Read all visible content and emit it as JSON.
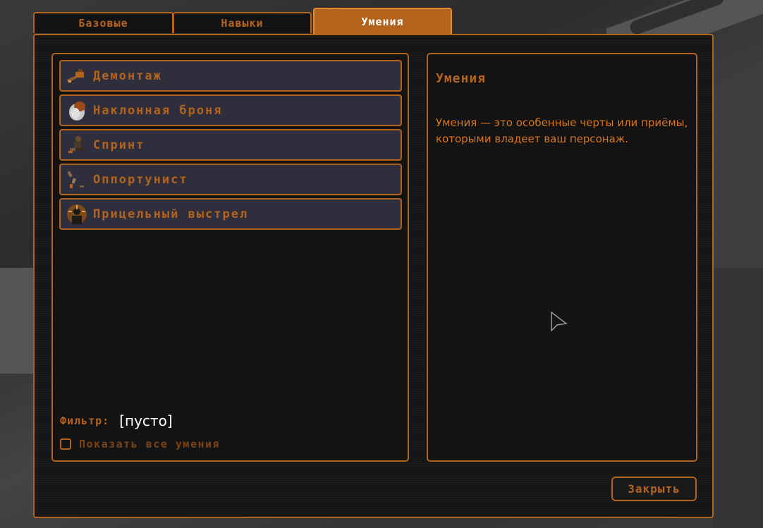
{
  "tabs": [
    {
      "label": "Базовые",
      "active": false
    },
    {
      "label": "Навыки",
      "active": false
    },
    {
      "label": "Умения",
      "active": true
    }
  ],
  "perks": [
    {
      "label": "Демонтаж",
      "icon": "wrench-icon"
    },
    {
      "label": "Наклонная броня",
      "icon": "armor-shield-icon"
    },
    {
      "label": "Спринт",
      "icon": "running-figure-icon"
    },
    {
      "label": "Оппортунист",
      "icon": "scattered-bullets-icon"
    },
    {
      "label": "Прицельный выстрел",
      "icon": "crosshair-head-icon"
    }
  ],
  "filter": {
    "label": "Фильтр:",
    "value": "[пусто]"
  },
  "show_all": {
    "label": "Показать все умения",
    "checked": false
  },
  "description": {
    "title": "Умения",
    "text": "Умения — это особенные черты или приёмы, которыми владеет ваш персонаж."
  },
  "close_button": {
    "label": "Закрыть"
  },
  "colors": {
    "accent": "#b4631c",
    "panel_bg": "#151515",
    "item_bg": "#2e2e3d",
    "active_tab": "#b4631c"
  }
}
